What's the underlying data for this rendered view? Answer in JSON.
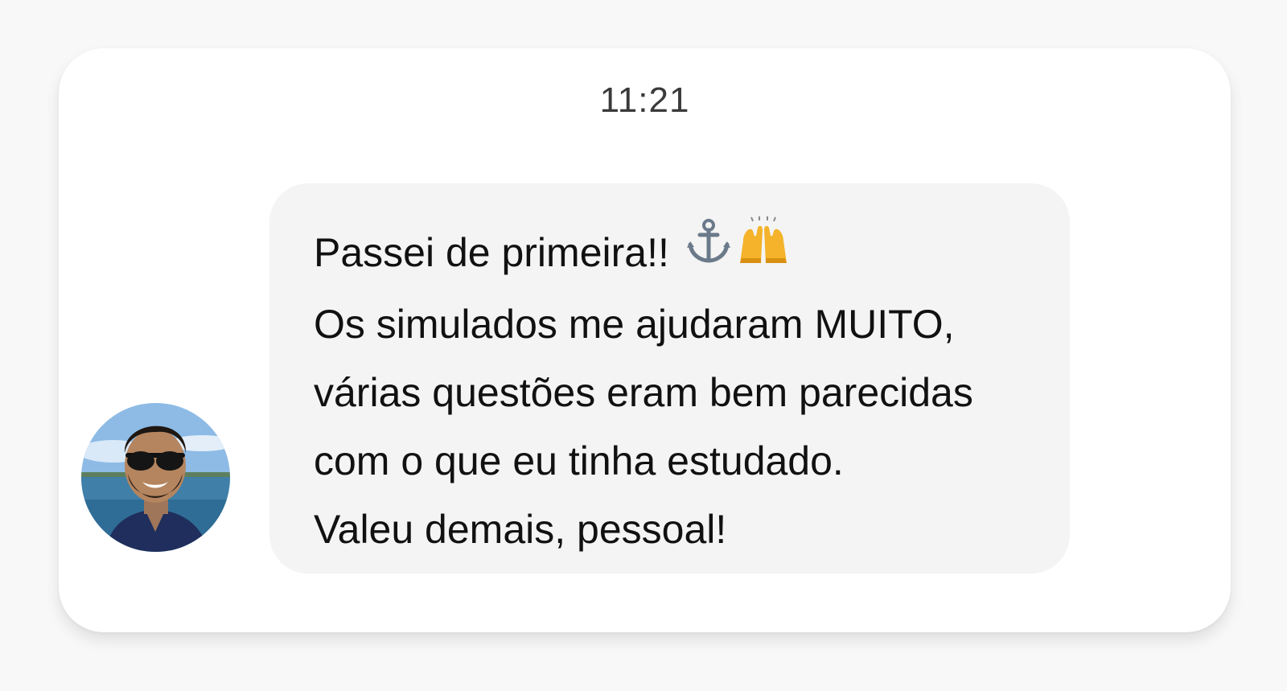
{
  "chat": {
    "timestamp": "11:21",
    "message": {
      "lines": [
        "Passei de primeira!!",
        "Os simulados me ajudaram MUITO,",
        "várias questões eram bem parecidas",
        "com o que eu tinha estudado.",
        "Valeu demais, pessoal!"
      ],
      "emojis": [
        "anchor-icon",
        "raising-hands-icon"
      ]
    },
    "sender": {
      "avatar": "avatar-photo"
    }
  },
  "colors": {
    "page_bg": "#f8f8f8",
    "card_bg": "#ffffff",
    "bubble_bg": "#f4f4f4",
    "text": "#111111",
    "timestamp_text": "#3a3a3a"
  }
}
